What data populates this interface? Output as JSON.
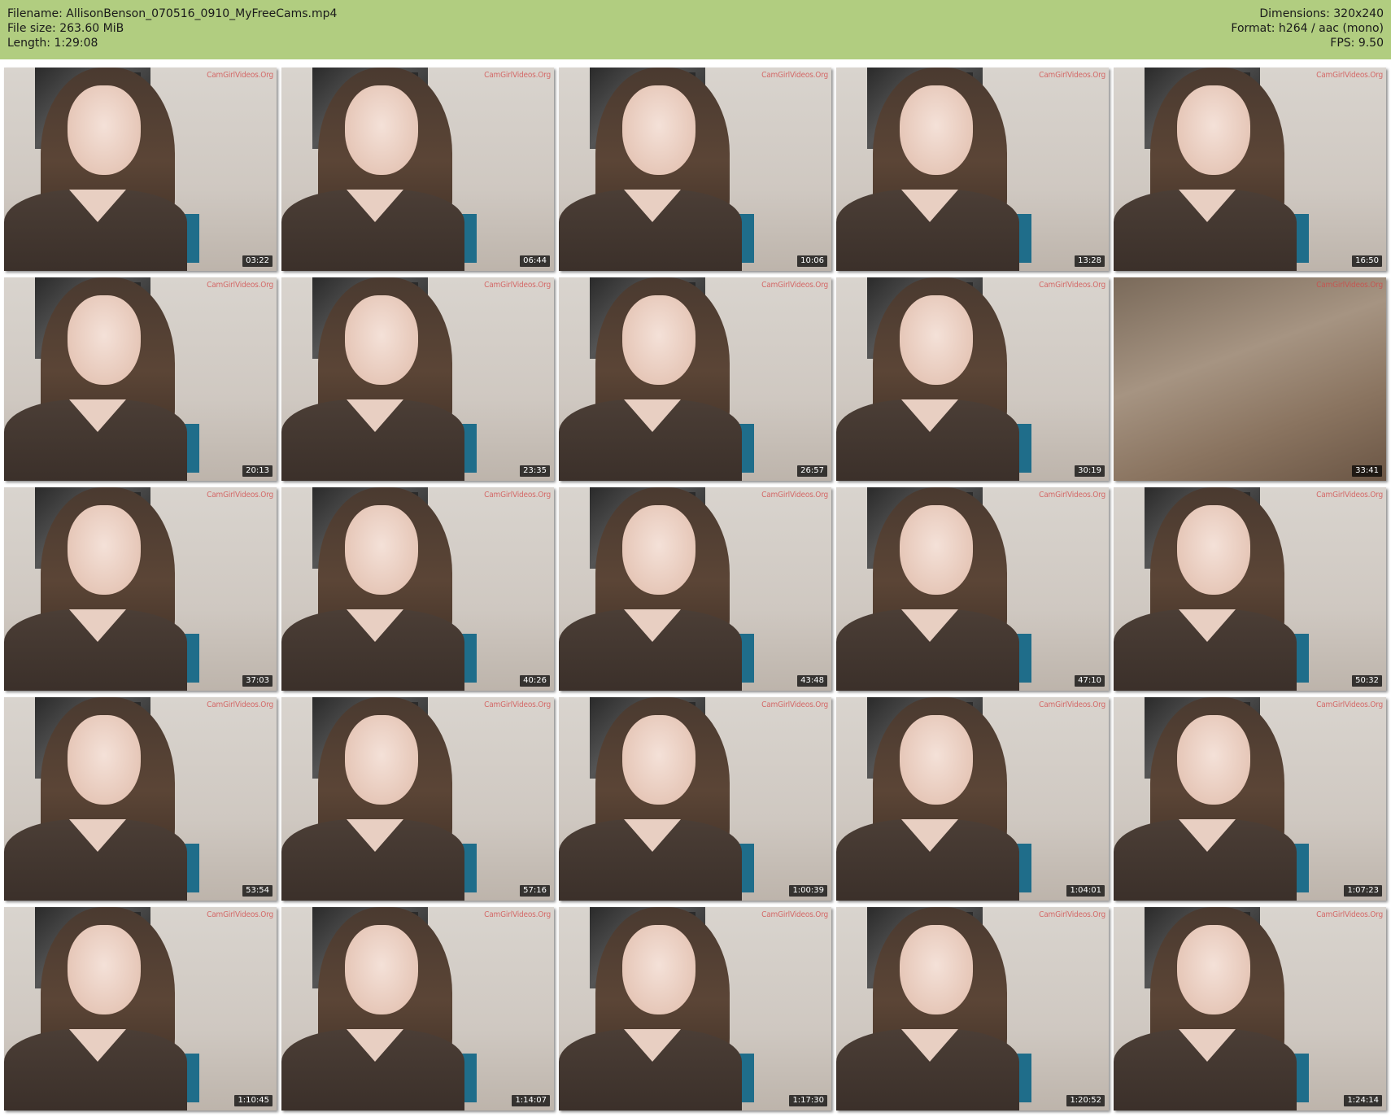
{
  "header": {
    "filename": "Filename: AllisonBenson_070516_0910_MyFreeCams.mp4",
    "filesize": "File size: 263.60 MiB",
    "length": "Length: 1:29:08",
    "dimensions": "Dimensions: 320x240",
    "format": "Format: h264 / aac (mono)",
    "fps": "FPS: 9.50"
  },
  "watermark": "CamGirlVideos.Org",
  "thumbnails": [
    {
      "time": "03:22"
    },
    {
      "time": "06:44"
    },
    {
      "time": "10:06"
    },
    {
      "time": "13:28"
    },
    {
      "time": "16:50"
    },
    {
      "time": "20:13"
    },
    {
      "time": "23:35"
    },
    {
      "time": "26:57"
    },
    {
      "time": "30:19"
    },
    {
      "time": "33:41"
    },
    {
      "time": "37:03"
    },
    {
      "time": "40:26"
    },
    {
      "time": "43:48"
    },
    {
      "time": "47:10"
    },
    {
      "time": "50:32"
    },
    {
      "time": "53:54"
    },
    {
      "time": "57:16"
    },
    {
      "time": "1:00:39"
    },
    {
      "time": "1:04:01"
    },
    {
      "time": "1:07:23"
    },
    {
      "time": "1:10:45"
    },
    {
      "time": "1:14:07"
    },
    {
      "time": "1:17:30"
    },
    {
      "time": "1:20:52"
    },
    {
      "time": "1:24:14"
    }
  ],
  "colors": {
    "header_bg": "#b1cd80",
    "timestamp_bg": "#000000",
    "watermark": "#d24646"
  }
}
